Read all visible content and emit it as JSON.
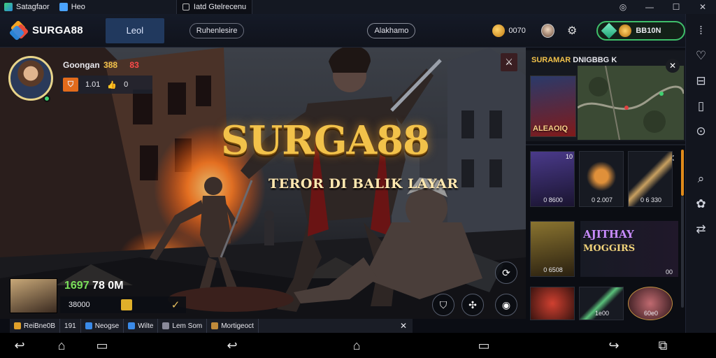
{
  "titlebar": {
    "app_name": "Satagfaor",
    "tab1": "Heo",
    "tab2": "Iatd Gtelrecenu",
    "ctrl_icons": [
      "target-icon",
      "minimize-icon",
      "maximize-icon",
      "close-icon"
    ]
  },
  "header": {
    "brand": "SURGA88",
    "active_tab": "Leol",
    "pill1": "Ruhenlesire",
    "pill2": "Alakhamo",
    "coins": "0070",
    "wallet": "BB10N"
  },
  "scene": {
    "title": "SURGA88",
    "subtitle": "TEROR DI BALIK LAYAR",
    "player": {
      "name": "Goongan",
      "name_tag": "388",
      "name_badge": "83",
      "stat1": "1.01",
      "stat2": "0"
    },
    "reward": {
      "value_green": "1697",
      "value_white": "78 0M",
      "bar_text": "38000"
    }
  },
  "panel": {
    "title_yellow": "SURAMAR",
    "title_white": "DNIGBBG",
    "title_suffix": "K",
    "char_label": "ALEAOIQ",
    "items": [
      {
        "num": "10",
        "label": "0 8600"
      },
      {
        "num": "",
        "label": "0 2.007"
      },
      {
        "num": "",
        "label": "0 6 330"
      },
      {
        "num": "",
        "label": "0 6508"
      },
      {
        "num": "",
        "label": "1e00"
      },
      {
        "num": "",
        "label": "60e0"
      }
    ],
    "promo_line1": "AJITHAY",
    "promo_line2": "MOGGIRS",
    "promo_num": "00"
  },
  "statusbar": {
    "items": [
      "ReiBne0B",
      "191",
      "Neogse",
      "Wilte",
      "Lem Som",
      "Mortigeoct"
    ]
  },
  "sidebar_icons": [
    "expand-icon",
    "heart-icon",
    "minus-square-icon",
    "book-icon",
    "location-icon",
    "search-icon",
    "gear-icon",
    "swap-icon"
  ],
  "colors": {
    "accent_gold": "#f2c24a",
    "wallet_green": "#3fbf6a",
    "reward_green": "#7ae05a"
  }
}
